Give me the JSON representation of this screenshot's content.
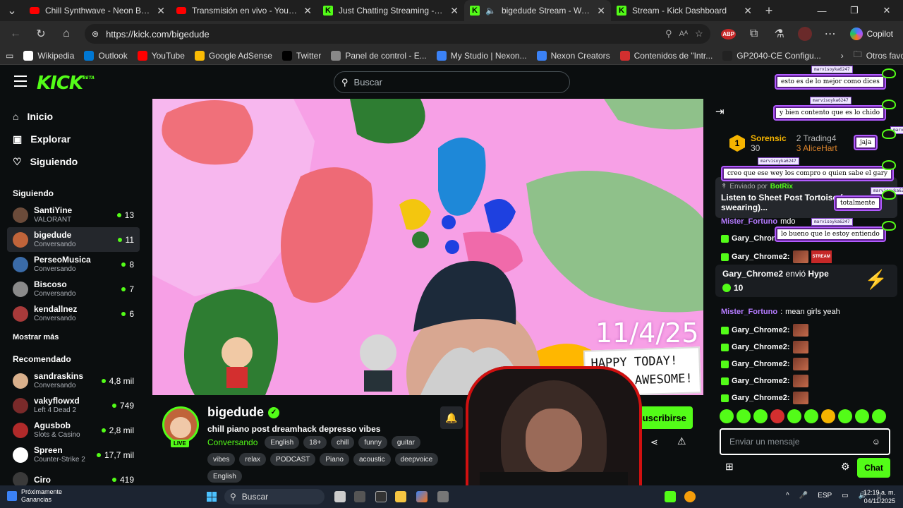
{
  "browser": {
    "tabs": [
      {
        "title": "Chill Synthwave - Neon Breeze by",
        "icon": "youtube-favicon"
      },
      {
        "title": "Transmisión en vivo - YouTube Stu",
        "icon": "youtube-favicon"
      },
      {
        "title": "Just Chatting Streaming - Live Stre",
        "icon": "kick-favicon"
      },
      {
        "title": "bigedude Stream - Watch Liv",
        "icon": "kick-favicon",
        "active": true
      },
      {
        "title": "Stream - Kick Dashboard",
        "icon": "kick-favicon"
      }
    ],
    "url": "https://kick.com/bigedude",
    "copilot_label": "Copilot",
    "bookmarks": [
      {
        "label": "Wikipedia",
        "color": "#ffffff"
      },
      {
        "label": "Outlook",
        "color": "#0078d4"
      },
      {
        "label": "YouTube",
        "color": "#ff0000"
      },
      {
        "label": "Google AdSense",
        "color": "#fbbc04"
      },
      {
        "label": "Twitter",
        "color": "#000000"
      },
      {
        "label": "Panel de control - E...",
        "color": "#888888"
      },
      {
        "label": "My Studio | Nexon...",
        "color": "#3b82f6"
      },
      {
        "label": "Nexon Creators",
        "color": "#3b82f6"
      },
      {
        "label": "Contenidos de \"Intr...",
        "color": "#d32f2f"
      },
      {
        "label": "GP2040-CE Configu...",
        "color": "#222222"
      }
    ],
    "other_favorites": "Otros favoritos"
  },
  "kick": {
    "logo_text": "KICK",
    "logo_sup": "BETA",
    "accent": "#53fc18",
    "search_placeholder": "Buscar",
    "nav": [
      {
        "label": "Inicio",
        "icon": "home-icon"
      },
      {
        "label": "Explorar",
        "icon": "compass-icon"
      },
      {
        "label": "Siguiendo",
        "icon": "heart-icon"
      }
    ],
    "following_title": "Siguiendo",
    "following": [
      {
        "name": "SantiYine",
        "category": "VALORANT",
        "viewers": "13",
        "color": "#6b4b3a"
      },
      {
        "name": "bigedude",
        "category": "Conversando",
        "viewers": "11",
        "color": "#c0643a",
        "active": true
      },
      {
        "name": "PerseoMusica",
        "category": "Conversando",
        "viewers": "8",
        "color": "#3a6ba8"
      },
      {
        "name": "Biscoso",
        "category": "Conversando",
        "viewers": "7",
        "color": "#8a8a8a"
      },
      {
        "name": "kendallnez",
        "category": "Conversando",
        "viewers": "6",
        "color": "#a83a3a"
      }
    ],
    "show_more": "Mostrar más",
    "recommended_title": "Recomendado",
    "recommended": [
      {
        "name": "sandraskins",
        "category": "Conversando",
        "viewers": "4,8 mil",
        "color": "#d9b08c"
      },
      {
        "name": "vakyflowxd",
        "category": "Left 4 Dead 2",
        "viewers": "749",
        "color": "#7a2a2a"
      },
      {
        "name": "Agusbob",
        "category": "Slots & Casino",
        "viewers": "2,8 mil",
        "color": "#b02a2a"
      },
      {
        "name": "Spreen",
        "category": "Counter-Strike 2",
        "viewers": "17,7 mil",
        "color": "#ffffff"
      },
      {
        "name": "Ciro",
        "category": "",
        "viewers": "419",
        "color": "#3a3a3a"
      }
    ]
  },
  "video": {
    "date_text": "11/4/25",
    "sign_line1": "HAPPY TODAY!",
    "sign_line2": "U ARE AWESOME!"
  },
  "channel": {
    "name": "bigedude",
    "live_label": "LIVE",
    "stream_title": "chill piano post dreamhack depresso vibes",
    "category": "Conversando",
    "tags": [
      "English",
      "18+",
      "chill",
      "funny",
      "guitar",
      "vibes",
      "relax",
      "PODCAST",
      "Piano",
      "acoustic",
      "deepvoice",
      "English"
    ],
    "subscribe_label": "Suscribirse"
  },
  "chat": {
    "podium": [
      {
        "rank": "1",
        "name": "Sorensic",
        "value": "30"
      },
      {
        "rank": "2",
        "name": "Trading4"
      },
      {
        "rank": "3",
        "name": "AliceHart"
      }
    ],
    "pinned_by_prefix": "Enviado por",
    "pinned_by": "BotRix",
    "pinned_text": "Listen to Sheet Post Tortoise (",
    "pinned_text2": "swearing)...",
    "messages": [
      {
        "user": "Mister_Fortuno",
        "text": "mdo",
        "color": "#b57bff"
      },
      {
        "user": "Gary_Chrome2:",
        "text": "",
        "color": "#ffffff"
      },
      {
        "user": "Gary_Chrome2:",
        "text": "",
        "color": "#ffffff"
      }
    ],
    "hype": {
      "user": "Gary_Chrome2",
      "text": "envió",
      "item": "Hype",
      "count": "10"
    },
    "after_hype": [
      {
        "user": "Mister_Fortuno",
        "text": "mean girls yeah",
        "color": "#b57bff"
      },
      {
        "user": "Gary_Chrome2:",
        "text": ""
      },
      {
        "user": "Gary_Chrome2:",
        "text": ""
      },
      {
        "user": "Gary_Chrome2:",
        "text": ""
      },
      {
        "user": "Gary_Chrome2:",
        "text": ""
      },
      {
        "user": "Gary_Chrome2:",
        "text": ""
      }
    ],
    "input_placeholder": "Enviar un mensaje",
    "send_label": "Chat"
  },
  "overlay_chat": [
    {
      "handle": "marvisoyka6247",
      "text": "esto es de lo mejor como dices"
    },
    {
      "handle": "marvisoyka6247",
      "text": "y bien contento que es lo chido"
    },
    {
      "handle": "marvisoyka6247",
      "text": "jaja"
    },
    {
      "handle": "marvisoyka6247",
      "text": "creo que ese wey los compro o quien sabe el gary"
    },
    {
      "handle": "marvisoyka6247",
      "text": "totalmente"
    },
    {
      "handle": "marvisoyka6247",
      "text": "lo bueno que le estoy entiendo"
    }
  ],
  "taskbar": {
    "weather_line1": "Próximamente",
    "weather_line2": "Ganancias",
    "search_label": "Buscar",
    "lang": "ESP",
    "time": "12:19 a. m.",
    "date": "04/11/2025"
  }
}
